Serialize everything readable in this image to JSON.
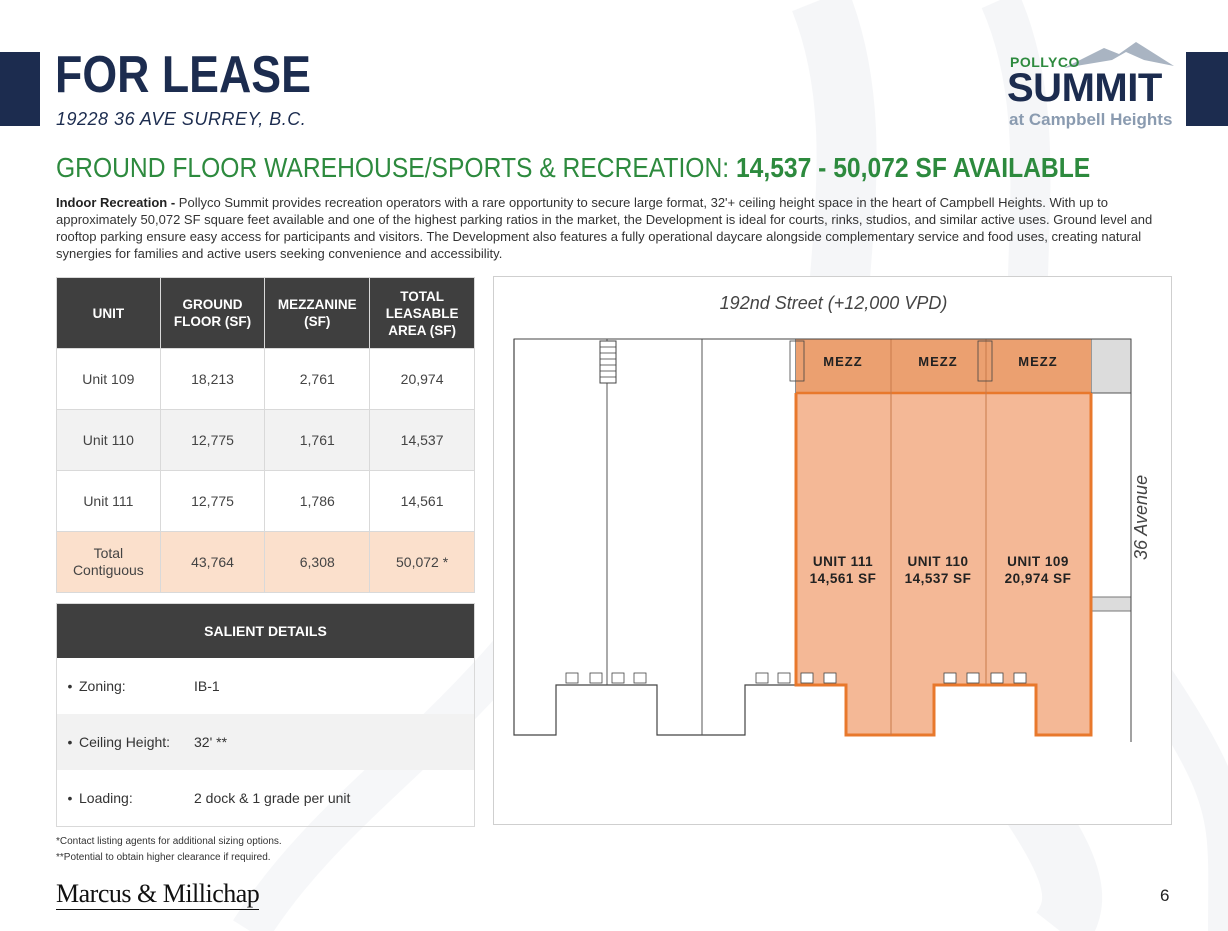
{
  "header": {
    "title": "FOR LEASE",
    "address": "19228 36 AVE SURREY, B.C."
  },
  "logo": {
    "line1": "POLLYCO",
    "line2": "SUMMIT",
    "line3": "at Campbell Heights"
  },
  "heading": {
    "prefix": "GROUND FLOOR WAREHOUSE/SPORTS & RECREATION: ",
    "highlight": "14,537 - 50,072 SF AVAILABLE"
  },
  "description": {
    "lead": "Indoor Recreation -",
    "body": " Pollyco Summit provides recreation operators with a rare opportunity to secure large format, 32'+ ceiling height space in the heart of Campbell Heights. With up to approximately 50,072 SF square feet available and one of the highest parking ratios in the market, the Development is ideal for courts, rinks, studios, and similar active uses. Ground level and rooftop parking ensure easy access for participants and visitors. The Development also features a fully operational daycare alongside complementary service and food uses, creating natural synergies for families and active users seeking convenience and accessibility."
  },
  "unit_table": {
    "headers": [
      "UNIT",
      "GROUND FLOOR (SF)",
      "MEZZANINE (SF)",
      "TOTAL LEASABLE AREA (SF)"
    ],
    "rows": [
      [
        "Unit 109",
        "18,213",
        "2,761",
        "20,974"
      ],
      [
        "Unit 110",
        "12,775",
        "1,761",
        "14,537"
      ],
      [
        "Unit 111",
        "12,775",
        "1,786",
        "14,561"
      ]
    ],
    "total": [
      "Total Contiguous",
      "43,764",
      "6,308",
      "50,072 *"
    ]
  },
  "salient": {
    "title": "SALIENT DETAILS",
    "items": [
      {
        "label": "Zoning:",
        "value": "IB-1"
      },
      {
        "label": "Ceiling Height:",
        "value": "32' **"
      },
      {
        "label": "Loading:",
        "value": "2 dock & 1 grade per unit"
      }
    ]
  },
  "site_plan": {
    "street": "192nd Street (+12,000 VPD)",
    "avenue": "36 Avenue",
    "mezz_label": "MEZZ",
    "units": [
      {
        "name": "UNIT 111",
        "area": "14,561 SF"
      },
      {
        "name": "UNIT 110",
        "area": "14,537 SF"
      },
      {
        "name": "UNIT 109",
        "area": "20,974 SF"
      }
    ],
    "highlight_color": "#f4b896",
    "mezz_color": "#eba070",
    "outline_color": "#e8782c"
  },
  "footnotes": [
    "*Contact listing agents for additional sizing options.",
    "**Potential to obtain higher clearance if required."
  ],
  "footer": {
    "brand": "Marcus & Millichap",
    "page": "6"
  },
  "colors": {
    "navy": "#1c2c4f",
    "green": "#2d8a3e",
    "table_header": "#3f3f3f"
  }
}
